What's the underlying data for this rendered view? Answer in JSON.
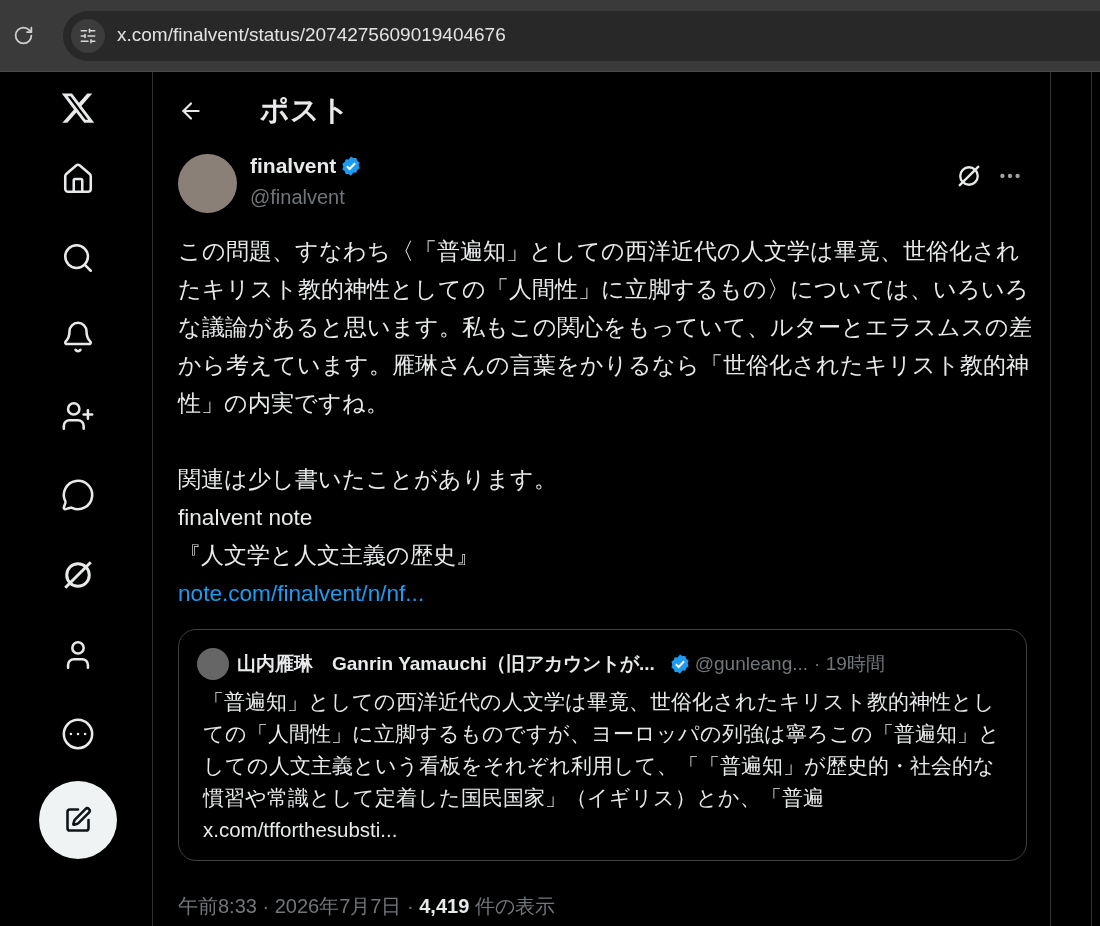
{
  "browser": {
    "url": "x.com/finalvent/status/2074275609019404676"
  },
  "header": {
    "title": "ポスト"
  },
  "post": {
    "author": {
      "name": "finalvent",
      "handle": "@finalvent",
      "verified": true
    },
    "paragraphs": [
      "この問題、すなわち〈「普遍知」としての西洋近代の人文学は畢竟、世俗化されたキリスト教的神性としての「人間性」に立脚するもの〉については、いろいろな議論があると思います。私もこの関心をもっていて、ルターとエラスムスの差から考えています。雁琳さんの言葉をかりるなら「世俗化されたキリスト教的神性」の内実ですね。"
    ],
    "lines": [
      "関連は少し書いたことがあります。",
      "finalvent note",
      "『人文学と人文主義の歴史』"
    ],
    "link": "note.com/finalvent/n/nf...",
    "quote": {
      "name": "山内雁琳　Ganrin Yamauchi（旧アカウントが...",
      "verified": true,
      "handle": "@gunleang...",
      "time": "· 19時間",
      "text": "「普遍知」としての西洋近代の人文学は畢竟、世俗化されたキリスト教的神性としての「人間性」に立脚するものですが、ヨーロッパの列強は寧ろこの「普遍知」としての人文主義という看板をそれぞれ利用して、「「普遍知」が歴史的・社会的な慣習や常識として定着した国民国家」（イギリス）とか、「普遍",
      "link": "x.com/tfforthesubsti..."
    },
    "meta": {
      "time": "午前8:33 · 2026年7月7日 · ",
      "views": "4,419",
      "views_label": " 件の表示"
    }
  }
}
